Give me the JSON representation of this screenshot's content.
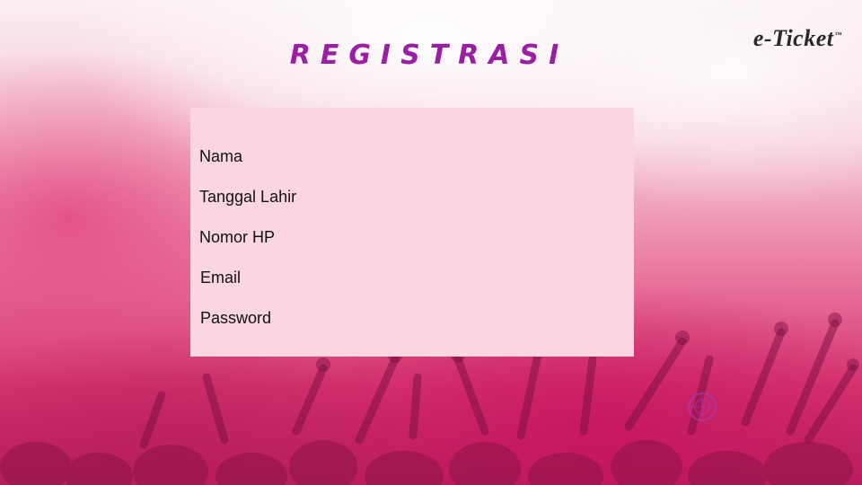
{
  "brand": {
    "logo_text": "e-Ticket",
    "trademark": "™"
  },
  "title": "REGISTRASI",
  "form": {
    "fields": [
      {
        "label": "Nama"
      },
      {
        "label": "Tanggal Lahir"
      },
      {
        "label": "Nomor HP"
      },
      {
        "label": "Email"
      },
      {
        "label": "Password"
      }
    ]
  },
  "colors": {
    "title": "#9b1fa3",
    "form_background": "#fbd5df",
    "logo": "#2a2a2a"
  }
}
